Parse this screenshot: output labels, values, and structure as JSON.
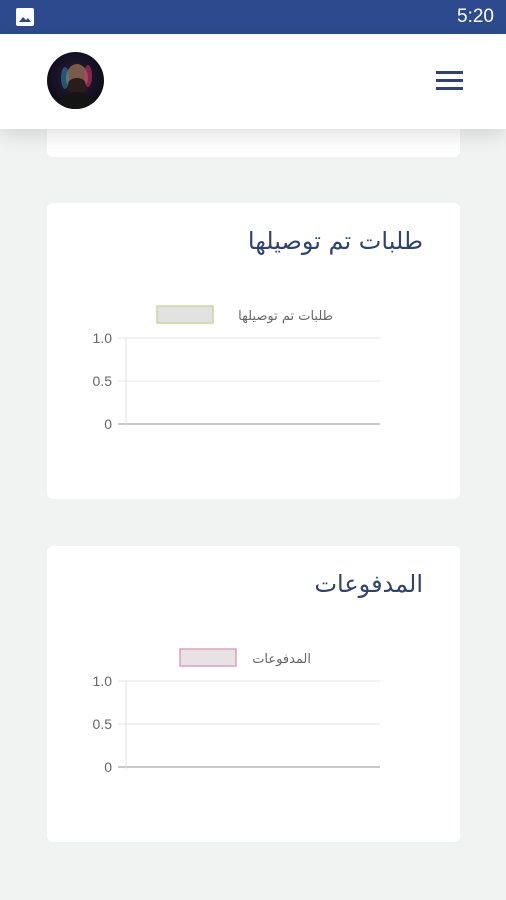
{
  "status_bar": {
    "time": "5:20",
    "bar_color": "#2c4a8d",
    "gallery_icon": "image-icon"
  },
  "header": {
    "avatar_icon": "user-avatar",
    "menu_icon": "hamburger-menu-icon",
    "accent_color": "#2c4a8d"
  },
  "cards": [
    {
      "title": "طلبات تم توصيلها"
    },
    {
      "title": "المدفوعات"
    }
  ],
  "chart_data": [
    {
      "type": "bar",
      "title": "",
      "legend_position": "top",
      "categories": [],
      "series": [
        {
          "name": "طلبات تم توصيلها",
          "values": [],
          "color": "#e2e2e2",
          "border": "#c9d89c"
        }
      ],
      "ylim": [
        0,
        1.0
      ],
      "yticks": [
        "1.0",
        "0.5",
        "0"
      ],
      "grid": true
    },
    {
      "type": "bar",
      "title": "",
      "legend_position": "top",
      "categories": [],
      "series": [
        {
          "name": "المدفوعات",
          "values": [],
          "color": "#e8e2e5",
          "border": "#d7a3c2"
        }
      ],
      "ylim": [
        0,
        1.0
      ],
      "yticks": [
        "1.0",
        "0.5",
        "0"
      ],
      "grid": true
    }
  ]
}
